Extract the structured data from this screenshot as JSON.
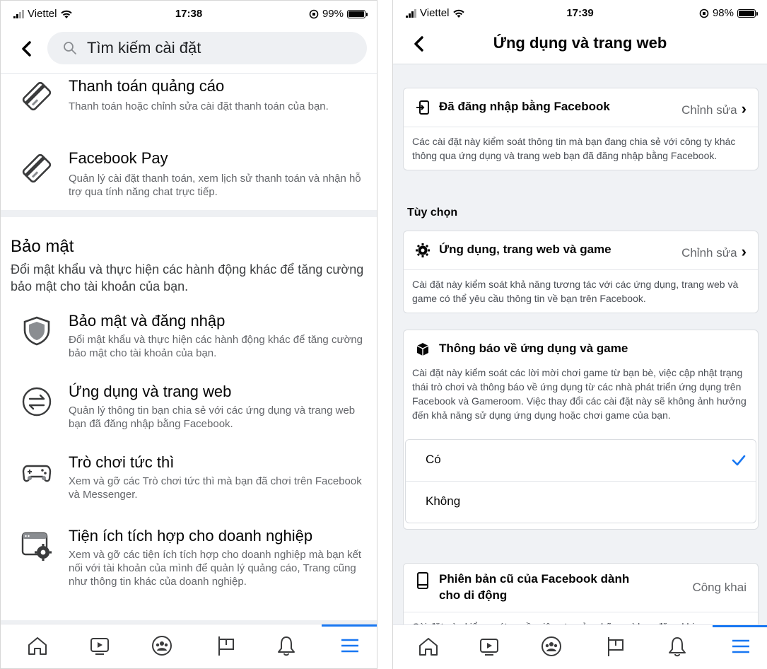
{
  "left": {
    "status": {
      "carrier": "Viettel",
      "time": "17:38",
      "battery": "99%",
      "battery_level": 0.99
    },
    "search": {
      "placeholder": "Tìm kiếm cài đặt"
    },
    "items_top": [
      {
        "title": "Thanh toán quảng cáo",
        "desc": "Thanh toán hoặc chỉnh sửa cài đặt thanh toán của bạn.",
        "icon": "credit-card-icon"
      },
      {
        "title": "Facebook Pay",
        "desc": "Quản lý cài đặt thanh toán, xem lịch sử thanh toán và nhận hỗ trợ qua tính năng chat trực tiếp.",
        "icon": "credit-card-icon"
      }
    ],
    "security": {
      "title": "Bảo mật",
      "desc": "Đổi mật khẩu và thực hiện các hành động khác để tăng cường bảo mật cho tài khoản của bạn."
    },
    "items_security": [
      {
        "title": "Bảo mật và đăng nhập",
        "desc": "Đổi mật khẩu và thực hiện các hành động khác để tăng cường bảo mật cho tài khoản của bạn.",
        "icon": "shield-icon"
      },
      {
        "title": "Ứng dụng và trang web",
        "desc": "Quản lý thông tin bạn chia sẻ với các ứng dụng và trang web bạn đã đăng nhập bằng Facebook.",
        "icon": "arrows-exchange-icon"
      },
      {
        "title": "Trò chơi tức thì",
        "desc": "Xem và gỡ các Trò chơi tức thì mà bạn đã chơi trên Facebook và Messenger.",
        "icon": "gamepad-icon"
      },
      {
        "title": "Tiện ích tích hợp cho doanh nghiệp",
        "desc": "Xem và gỡ các tiện ích tích hợp cho doanh nghiệp mà bạn kết nối với tài khoản của mình để quản lý quảng cáo, Trang cũng như thông tin khác của doanh nghiệp.",
        "icon": "browser-gear-icon"
      }
    ]
  },
  "right": {
    "status": {
      "carrier": "Viettel",
      "time": "17:39",
      "battery": "98%",
      "battery_level": 0.98
    },
    "title": "Ứng dụng và trang web",
    "logged_in": {
      "title": "Đã đăng nhập bằng Facebook",
      "edit": "Chỉnh sửa",
      "desc": "Các cài đặt này kiểm soát thông tin mà bạn đang chia sẻ với công ty khác thông qua ứng dụng và trang web bạn đã đăng nhập bằng Facebook."
    },
    "options_label": "Tùy chọn",
    "apps_games": {
      "title": "Ứng dụng, trang web và game",
      "edit": "Chỉnh sửa",
      "desc": "Cài đặt này kiểm soát khả năng tương tác với các ứng dụng, trang web và game có thể yêu cầu thông tin về bạn trên Facebook."
    },
    "notifications": {
      "title": "Thông báo về ứng dụng và game",
      "desc": "Cài đặt này kiểm soát các lời mời chơi game từ bạn bè, việc cập nhật trạng thái trò chơi và thông báo về ứng dụng từ các nhà phát triển ứng dụng trên Facebook và Gameroom. Việc thay đổi các cài đặt này sẽ không ảnh hưởng đến khả năng sử dụng ứng dụng hoặc chơi game của bạn.",
      "choices": [
        "Có",
        "Không"
      ],
      "selected": "Có"
    },
    "old_versions": {
      "title_line1": "Phiên bản cũ của Facebook dành",
      "title_line2": "cho di động",
      "value": "Công khai",
      "desc": "Cài đặt này kiểm soát quyền riêng tư của những gì bạn đăng khi"
    }
  },
  "tabs": [
    "home-icon",
    "watch-icon",
    "groups-icon",
    "pages-flag-icon",
    "notifications-bell-icon",
    "menu-icon"
  ],
  "colors": {
    "accent": "#1877f2",
    "secondary_text": "#65676b",
    "divider": "#eef0f3"
  }
}
